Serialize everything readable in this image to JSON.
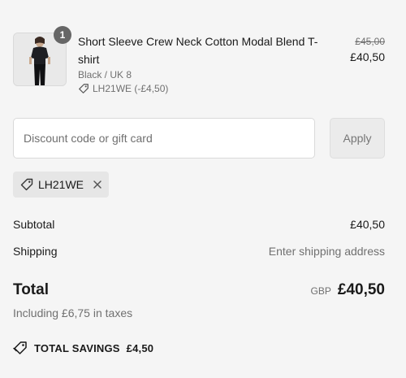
{
  "line_item": {
    "quantity": "1",
    "title": "Short Sleeve Crew Neck Cotton Modal Blend T-shirt",
    "variant": "Black / UK 8",
    "discount": "LH21WE (-£4,50)",
    "original_price": "£45,00",
    "price": "£40,50"
  },
  "discount": {
    "placeholder": "Discount code or gift card",
    "apply_label": "Apply",
    "applied_code": "LH21WE"
  },
  "summary": {
    "subtotal_label": "Subtotal",
    "subtotal_value": "£40,50",
    "shipping_label": "Shipping",
    "shipping_value": "Enter shipping address",
    "total_label": "Total",
    "currency": "GBP",
    "total_value": "£40,50",
    "taxes_note": "Including £6,75 in taxes",
    "savings_label": "TOTAL SAVINGS",
    "savings_value": "£4,50"
  }
}
